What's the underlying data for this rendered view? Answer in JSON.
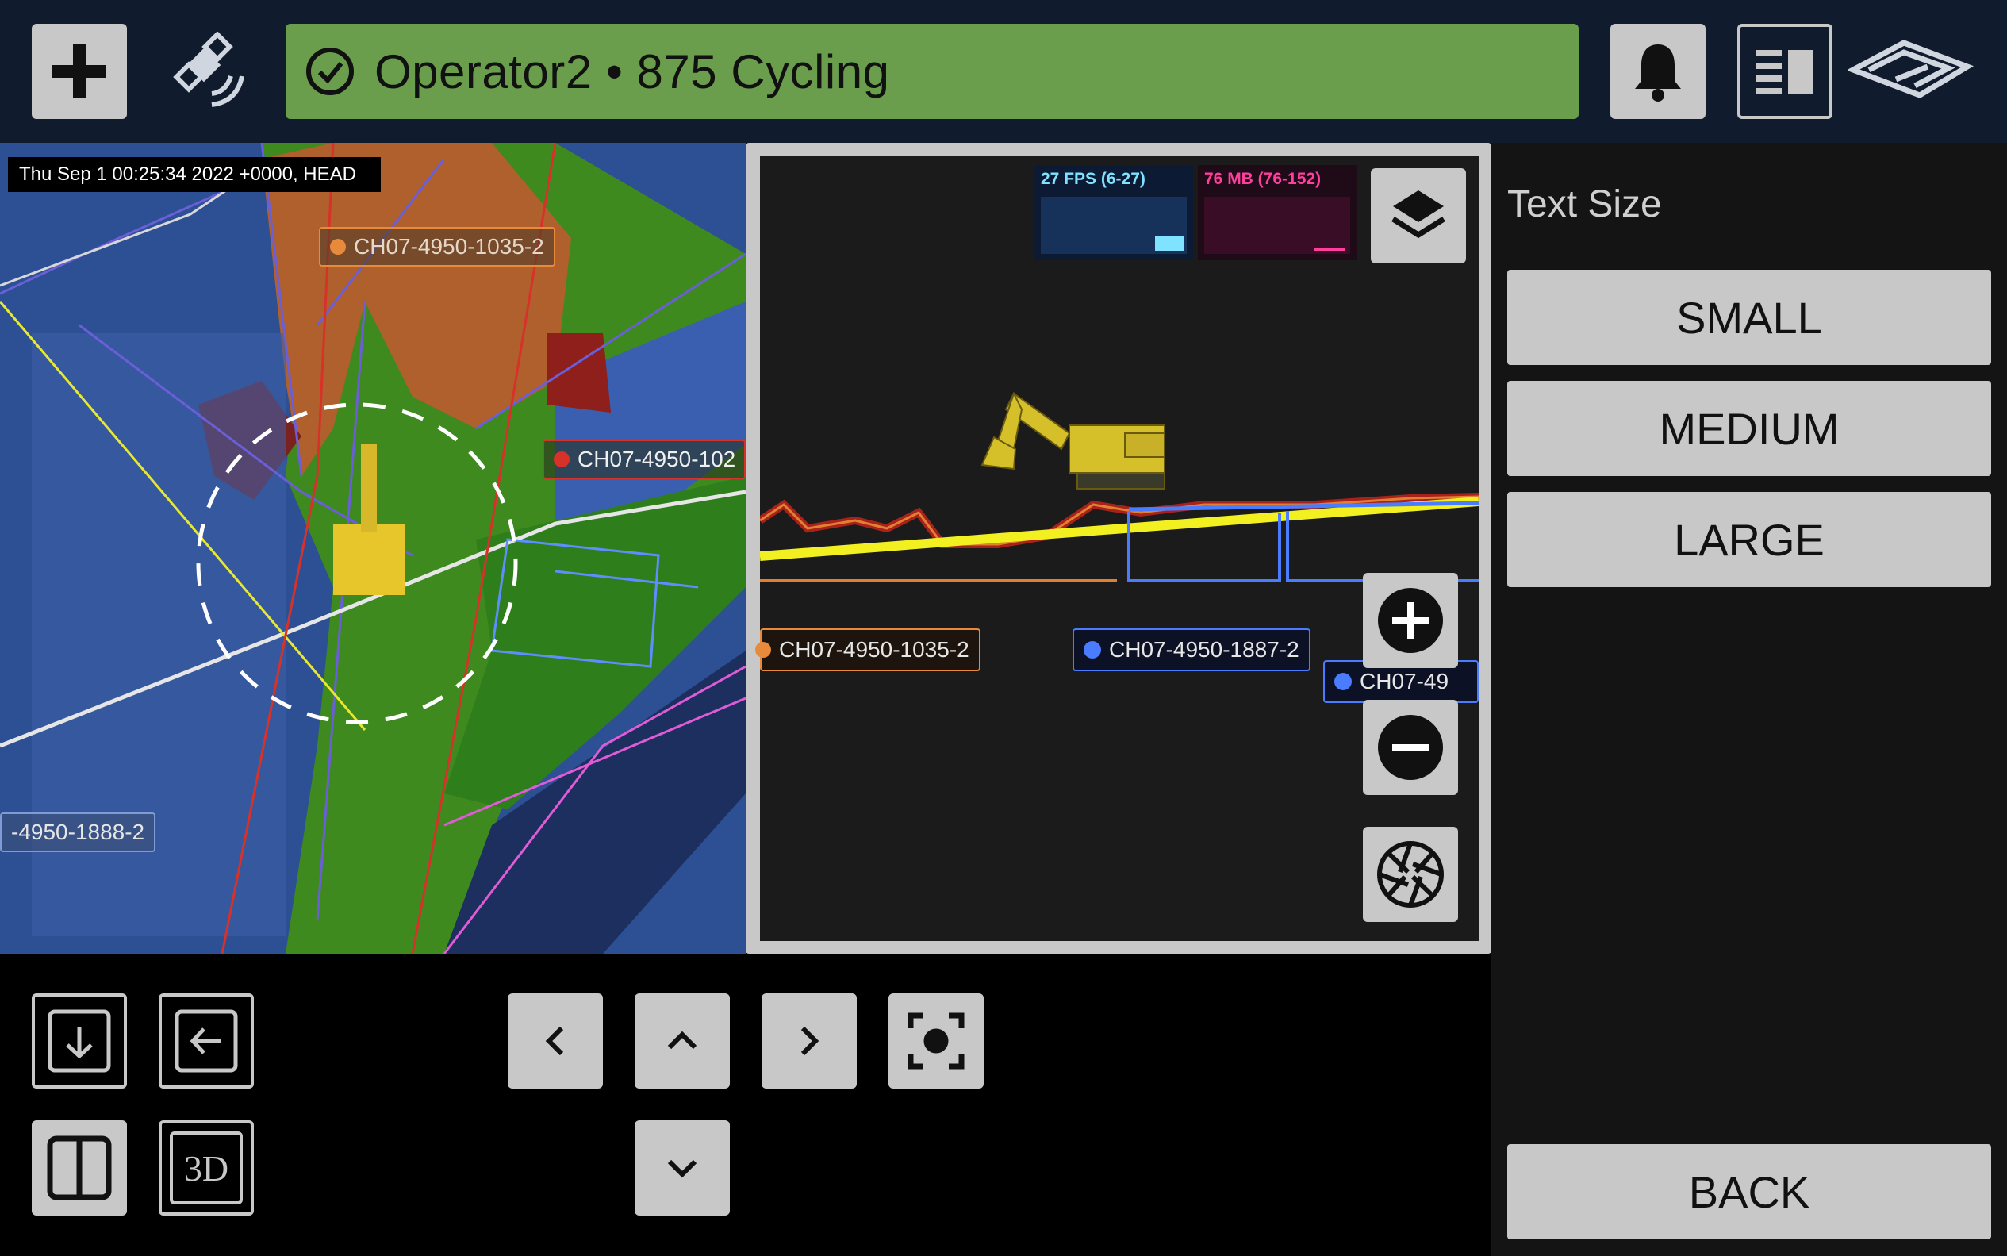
{
  "header": {
    "add_icon": "plus-icon",
    "gps_icon": "satellite-icon",
    "status_icon": "check-circle-icon",
    "status_text": "Operator2 • 875 Cycling",
    "status_color": "#6a9e4d",
    "notifications_icon": "bell-icon",
    "panel_icon": "panel-layout-icon",
    "logo_icon": "brand-logo-icon"
  },
  "map": {
    "timestamp": "Thu Sep 1 00:25:34 2022 +0000, HEAD",
    "labels": [
      {
        "text": "CH07-4950-1035-2",
        "color": "#e88a3c"
      },
      {
        "text": "CH07-4950-102",
        "color": "#d6322a"
      },
      {
        "text": "-4950-1888-2",
        "color": "#7f9bd6"
      }
    ]
  },
  "profile": {
    "fps_text": "27 FPS (6-27)",
    "mem_text": "76 MB (76-152)",
    "fps_color": "#7fe3ff",
    "mem_color": "#ff3f9e",
    "labels": [
      {
        "text": "CH07-4950-1035-2",
        "color": "#e88a3c"
      },
      {
        "text": "CH07-4950-1887-2",
        "color": "#4a7cff"
      },
      {
        "text": "CH07-49",
        "color": "#4a7cff"
      }
    ],
    "layers_icon": "layers-icon",
    "zoom_in_icon": "zoom-in-icon",
    "zoom_out_icon": "zoom-out-icon",
    "camera_icon": "aperture-icon"
  },
  "side_panel": {
    "title": "Text Size",
    "options": [
      "SMALL",
      "MEDIUM",
      "LARGE"
    ],
    "back": "BACK"
  },
  "controls": {
    "view_3d_label": "3D"
  }
}
